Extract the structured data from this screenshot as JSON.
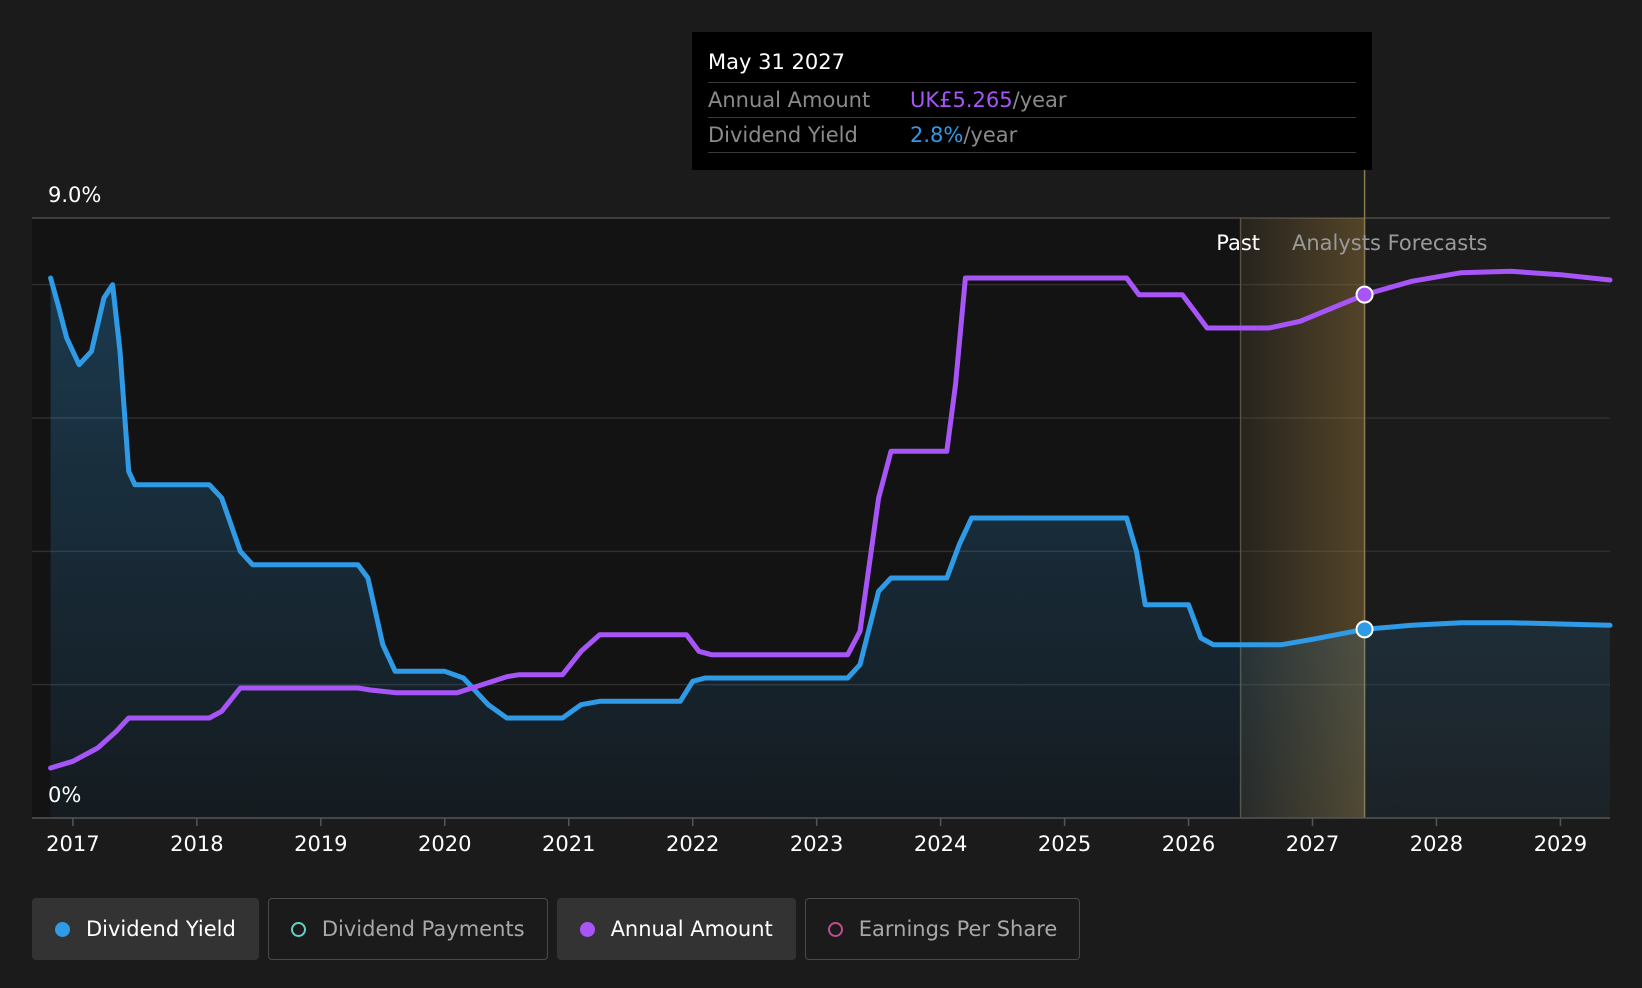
{
  "tooltip": {
    "date": "May 31 2027",
    "rows": [
      {
        "label": "Annual Amount",
        "value": "UK£5.265",
        "unit": "/year"
      },
      {
        "label": "Dividend Yield",
        "value": "2.8%",
        "unit": "/year"
      }
    ]
  },
  "chart_data": {
    "type": "line",
    "y_axis": {
      "top_label": "9.0%",
      "bottom_label": "0%",
      "ylim": [
        0,
        9.0
      ],
      "gridlines": [
        0,
        2,
        4,
        6,
        8,
        9
      ]
    },
    "x_axis": {
      "ticks": [
        "2017",
        "2018",
        "2019",
        "2020",
        "2021",
        "2022",
        "2023",
        "2024",
        "2025",
        "2026",
        "2027",
        "2028",
        "2029"
      ],
      "xlim": [
        2016.67,
        2029.4
      ]
    },
    "region_labels": {
      "past": "Past",
      "forecast": "Analysts Forecasts"
    },
    "forecast_start": 2026.42,
    "hover_x": 2027.42,
    "colors": {
      "dividend_yield": "#2f9be6",
      "annual_amount": "#a855f7",
      "dividend_payments": "#5fd4c4",
      "earnings_per_share": "#c04d8c"
    },
    "series": [
      {
        "name": "Dividend Yield",
        "points": [
          [
            2016.82,
            8.1
          ],
          [
            2016.88,
            7.7
          ],
          [
            2016.95,
            7.2
          ],
          [
            2017.05,
            6.8
          ],
          [
            2017.15,
            7.0
          ],
          [
            2017.25,
            7.8
          ],
          [
            2017.32,
            8.0
          ],
          [
            2017.38,
            7.0
          ],
          [
            2017.45,
            5.2
          ],
          [
            2017.5,
            5.0
          ],
          [
            2018.1,
            5.0
          ],
          [
            2018.2,
            4.8
          ],
          [
            2018.35,
            4.0
          ],
          [
            2018.45,
            3.8
          ],
          [
            2019.3,
            3.8
          ],
          [
            2019.38,
            3.6
          ],
          [
            2019.5,
            2.6
          ],
          [
            2019.6,
            2.2
          ],
          [
            2020.0,
            2.2
          ],
          [
            2020.15,
            2.1
          ],
          [
            2020.35,
            1.7
          ],
          [
            2020.5,
            1.5
          ],
          [
            2020.95,
            1.5
          ],
          [
            2021.1,
            1.7
          ],
          [
            2021.25,
            1.75
          ],
          [
            2021.9,
            1.75
          ],
          [
            2022.0,
            2.05
          ],
          [
            2022.1,
            2.1
          ],
          [
            2023.25,
            2.1
          ],
          [
            2023.35,
            2.3
          ],
          [
            2023.5,
            3.4
          ],
          [
            2023.6,
            3.6
          ],
          [
            2024.05,
            3.6
          ],
          [
            2024.15,
            4.1
          ],
          [
            2024.25,
            4.5
          ],
          [
            2025.5,
            4.5
          ],
          [
            2025.58,
            4.0
          ],
          [
            2025.65,
            3.2
          ],
          [
            2025.75,
            3.2
          ],
          [
            2026.0,
            3.2
          ],
          [
            2026.1,
            2.7
          ],
          [
            2026.2,
            2.6
          ],
          [
            2026.75,
            2.6
          ],
          [
            2027.0,
            2.68
          ],
          [
            2027.42,
            2.83
          ],
          [
            2027.8,
            2.89
          ],
          [
            2028.2,
            2.93
          ],
          [
            2028.6,
            2.93
          ],
          [
            2029.0,
            2.91
          ],
          [
            2029.4,
            2.89
          ]
        ]
      },
      {
        "name": "Annual Amount",
        "points": [
          [
            2016.82,
            0.75
          ],
          [
            2017.0,
            0.85
          ],
          [
            2017.2,
            1.05
          ],
          [
            2017.35,
            1.3
          ],
          [
            2017.45,
            1.5
          ],
          [
            2017.55,
            1.5
          ],
          [
            2018.1,
            1.5
          ],
          [
            2018.2,
            1.6
          ],
          [
            2018.35,
            1.95
          ],
          [
            2018.45,
            1.95
          ],
          [
            2019.3,
            1.95
          ],
          [
            2019.4,
            1.92
          ],
          [
            2019.6,
            1.88
          ],
          [
            2020.1,
            1.88
          ],
          [
            2020.3,
            2.0
          ],
          [
            2020.5,
            2.12
          ],
          [
            2020.6,
            2.15
          ],
          [
            2020.95,
            2.15
          ],
          [
            2021.1,
            2.5
          ],
          [
            2021.25,
            2.75
          ],
          [
            2021.95,
            2.75
          ],
          [
            2022.05,
            2.5
          ],
          [
            2022.15,
            2.45
          ],
          [
            2023.25,
            2.45
          ],
          [
            2023.35,
            2.8
          ],
          [
            2023.5,
            4.8
          ],
          [
            2023.6,
            5.5
          ],
          [
            2024.05,
            5.5
          ],
          [
            2024.12,
            6.5
          ],
          [
            2024.2,
            8.1
          ],
          [
            2024.25,
            8.1
          ],
          [
            2025.5,
            8.1
          ],
          [
            2025.6,
            7.85
          ],
          [
            2025.75,
            7.85
          ],
          [
            2025.95,
            7.85
          ],
          [
            2026.05,
            7.6
          ],
          [
            2026.15,
            7.35
          ],
          [
            2026.65,
            7.35
          ],
          [
            2026.9,
            7.45
          ],
          [
            2027.42,
            7.85
          ],
          [
            2027.8,
            8.05
          ],
          [
            2028.2,
            8.18
          ],
          [
            2028.6,
            8.2
          ],
          [
            2029.0,
            8.15
          ],
          [
            2029.4,
            8.07
          ]
        ]
      }
    ]
  },
  "legend": [
    {
      "label": "Dividend Yield",
      "active": true,
      "color_key": "dividend_yield"
    },
    {
      "label": "Dividend Payments",
      "active": false,
      "color_key": "dividend_payments"
    },
    {
      "label": "Annual Amount",
      "active": true,
      "color_key": "annual_amount"
    },
    {
      "label": "Earnings Per Share",
      "active": false,
      "color_key": "earnings_per_share"
    }
  ]
}
